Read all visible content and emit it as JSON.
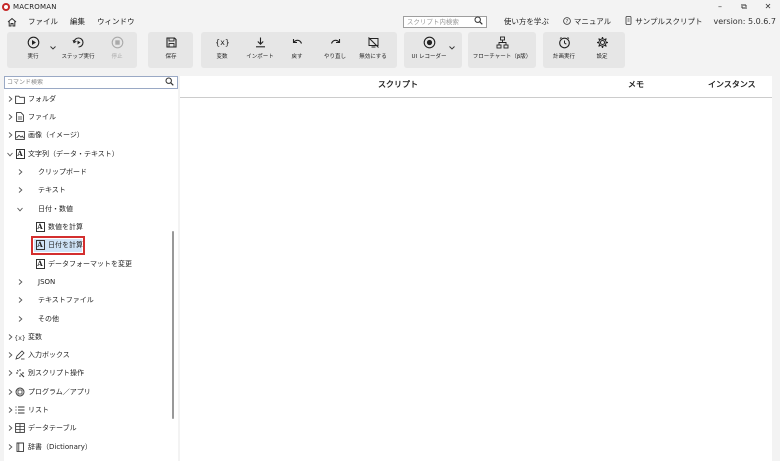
{
  "app": {
    "title": "MACROMAN",
    "version": "version: 5.0.6.7"
  },
  "window_controls": [
    "–",
    "⧉",
    "✕"
  ],
  "menu": {
    "items": [
      "ファイル",
      "編集",
      "ウィンドウ"
    ]
  },
  "header_right": {
    "search_placeholder": "スクリプト内検索",
    "how_to": "使い方を学ぶ",
    "manual": "マニュアル",
    "sample": "サンプルスクリプト"
  },
  "toolbar": {
    "run": "実行",
    "step_run": "ステップ実行",
    "stop": "停止",
    "save": "保存",
    "variables": "変数",
    "import": "インポート",
    "undo": "戻す",
    "redo": "やり直し",
    "disable": "無効にする",
    "ui_recorder": "UI レコーダー",
    "flowchart": "フローチャート（β版）",
    "schedule": "計画実行",
    "settings": "設定"
  },
  "sidebar": {
    "search_placeholder": "コマンド検索",
    "items": [
      {
        "label": "フォルダ",
        "icon": "folder-icon"
      },
      {
        "label": "ファイル",
        "icon": "file-icon"
      },
      {
        "label": "画像（イメージ）",
        "icon": "image-icon"
      },
      {
        "label": "文字列（データ・テキスト）",
        "icon": "text-a-icon",
        "expanded": true
      },
      {
        "label": "クリップボード"
      },
      {
        "label": "テキスト"
      },
      {
        "label": "日付・数値",
        "expanded": true
      },
      {
        "label": "数値を計算",
        "icon": "text-a-icon"
      },
      {
        "label": "日付を計算",
        "icon": "text-a-icon",
        "selected": true
      },
      {
        "label": "データフォーマットを変更",
        "icon": "text-a-icon"
      },
      {
        "label": "JSON"
      },
      {
        "label": "テキストファイル"
      },
      {
        "label": "その他"
      },
      {
        "label": "変数",
        "icon": "variable-icon"
      },
      {
        "label": "入力ボックス",
        "icon": "input-box-icon"
      },
      {
        "label": "別スクリプト操作",
        "icon": "script-op-icon"
      },
      {
        "label": "プログラム／アプリ",
        "icon": "program-icon"
      },
      {
        "label": "リスト",
        "icon": "list-icon"
      },
      {
        "label": "データテーブル",
        "icon": "table-icon"
      },
      {
        "label": "辞書（Dictionary）",
        "icon": "dictionary-icon"
      }
    ]
  },
  "main": {
    "columns": [
      "スクリプト",
      "メモ",
      "インスタンス"
    ]
  },
  "colors": {
    "selection_border": "#d32f2f",
    "selection_fill": "#cfe3f7"
  }
}
